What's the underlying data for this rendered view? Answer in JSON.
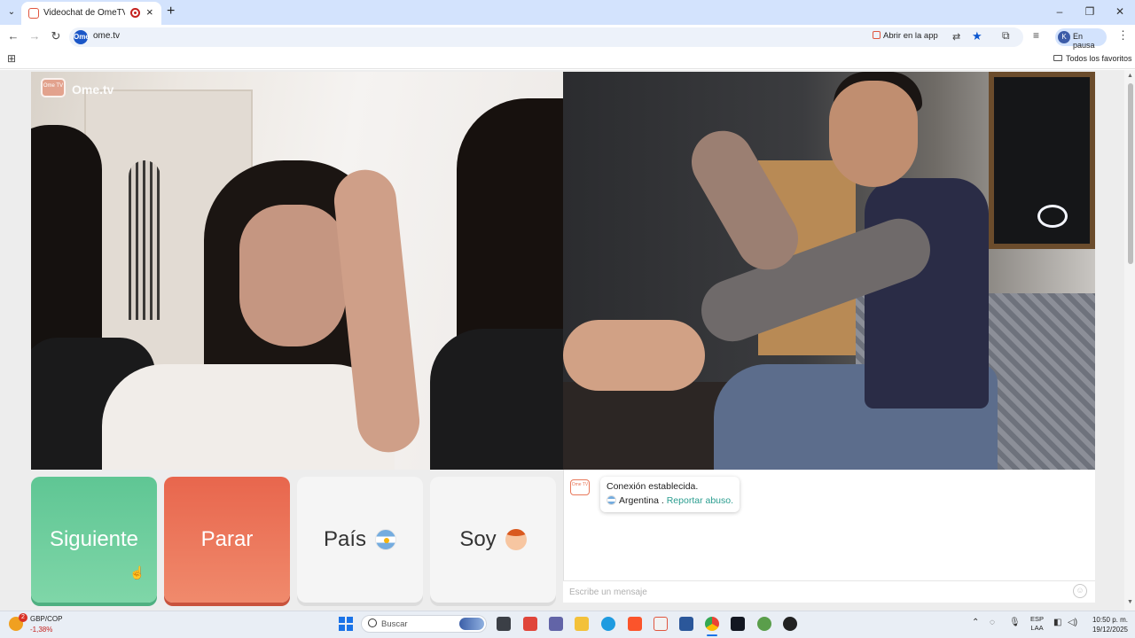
{
  "browser": {
    "tab_title": "Videochat de OmeTV: alter",
    "url": "ome.tv",
    "open_in_app": "Abrir en la app",
    "profile_initial": "K",
    "profile_status": "En pausa",
    "all_bookmarks": "Todos los favoritos",
    "site_icon_text": "Ome"
  },
  "video": {
    "logo_badge": "Ome TV",
    "logo_text": "Ome.tv"
  },
  "controls": {
    "next": "Siguiente",
    "stop": "Parar",
    "country": "País",
    "gender": "Soy",
    "country_flag": "argentina-flag-icon",
    "gender_icon": "boy-icon"
  },
  "chat": {
    "status": "Conexión establecida.",
    "country": "Argentina",
    "separator": ".",
    "report": "Reportar abuso.",
    "input_placeholder": "Escribe un mensaje",
    "logo_badge": "Ome TV"
  },
  "taskbar": {
    "ticker": "GBP/COP",
    "ticker_change": "-1,38%",
    "weather_badge": "2",
    "search": "Buscar",
    "lang_line1": "ESP",
    "lang_line2": "LAA",
    "time": "10:50 p. m.",
    "date": "19/12/2025"
  },
  "colors": {
    "next_button": "#6fcf9f",
    "stop_button": "#ec7558",
    "report_link": "#2a9d8f",
    "brand": "#e8785a"
  }
}
